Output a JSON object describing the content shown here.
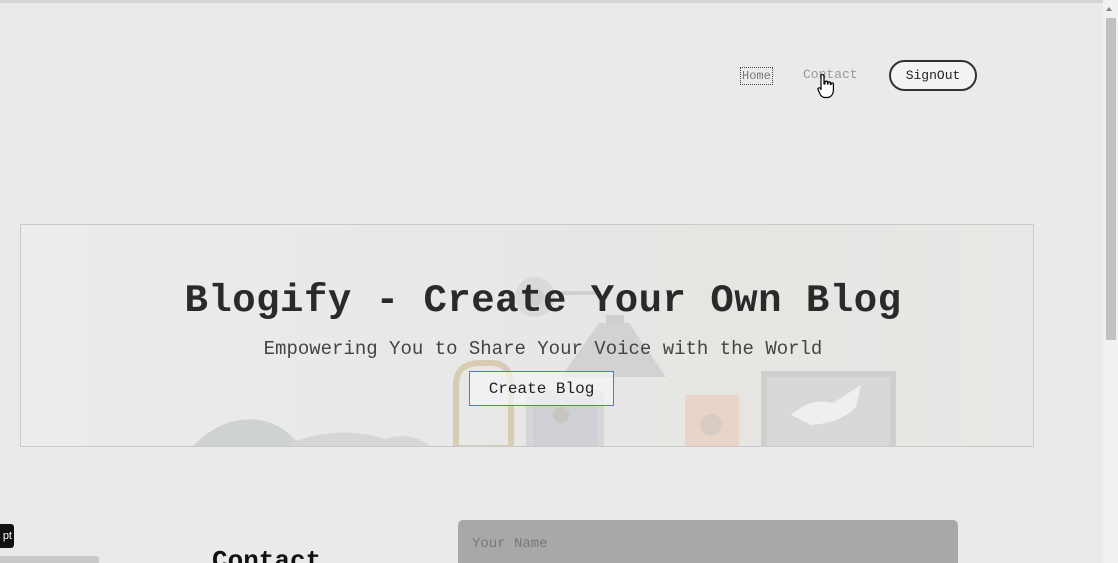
{
  "nav": {
    "home_label": "Home",
    "contact_label": "Contact",
    "signout_label": "SignOut"
  },
  "hero": {
    "title": "Blogify - Create Your Own Blog",
    "subtitle": "Empowering You to Share Your Voice with the World",
    "cta_label": "Create Blog"
  },
  "contact": {
    "heading": "Contact",
    "name_placeholder": "Your Name"
  },
  "overlay": {
    "tooltip_text": "pt"
  },
  "icons": {
    "cursor": "hand-pointer-icon",
    "scroll_up": "scroll-up-arrow-icon"
  },
  "colors": {
    "page_background": "#eaeaea",
    "cta_border": "#4a7fd0",
    "input_background": "#a8a8a8"
  }
}
